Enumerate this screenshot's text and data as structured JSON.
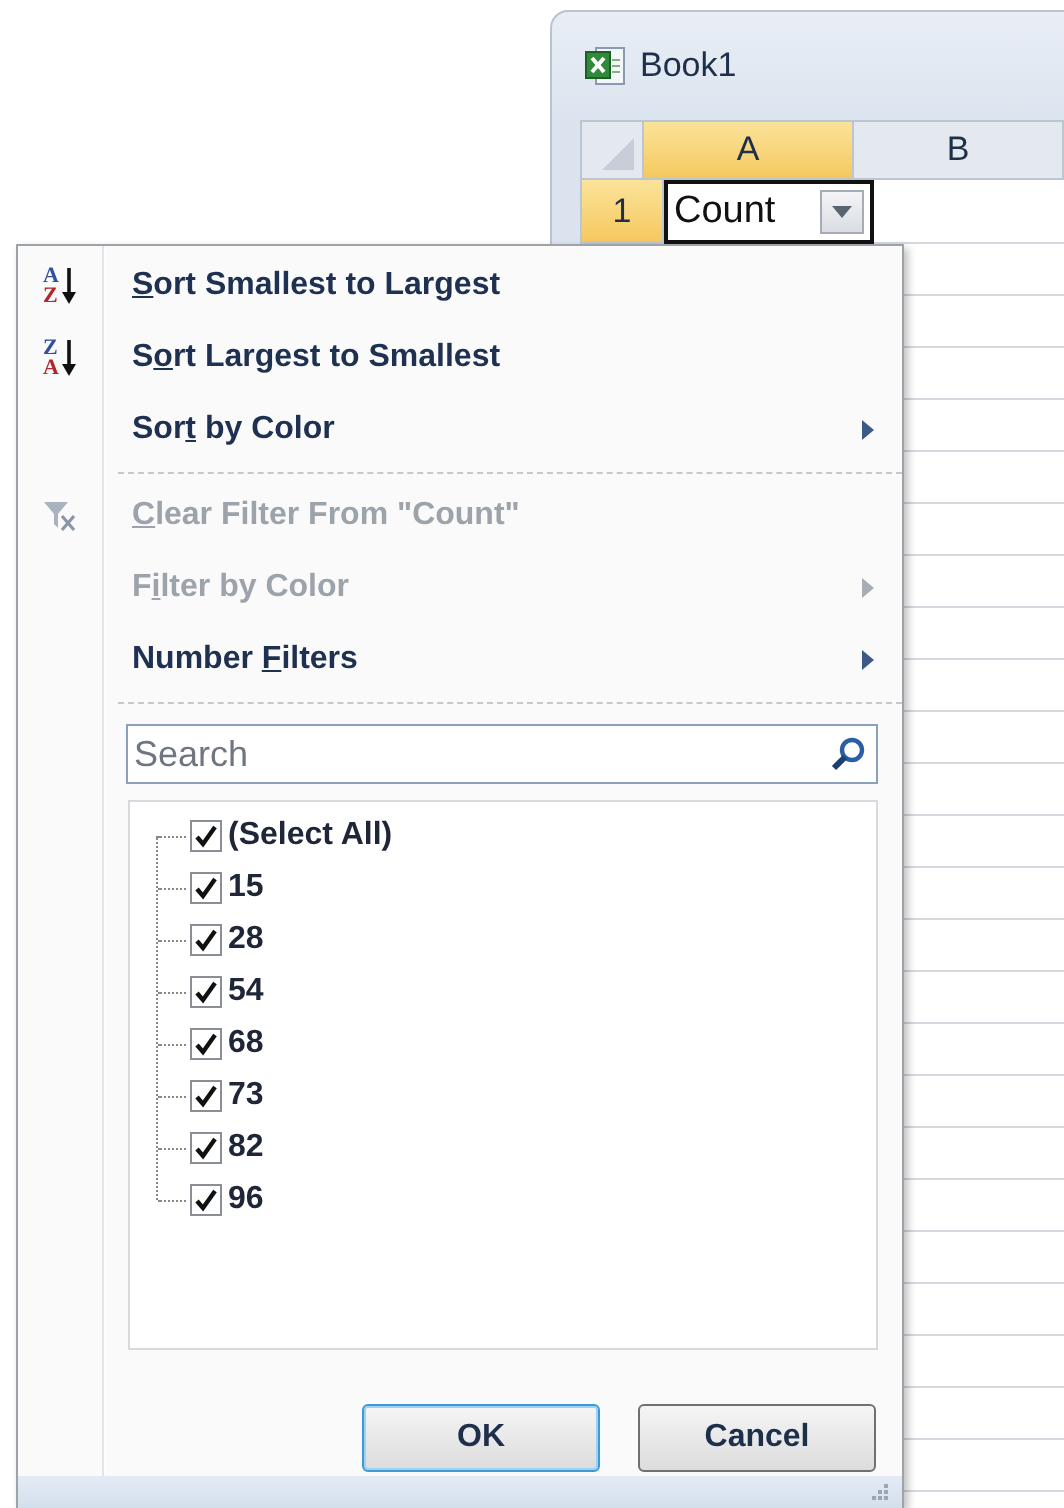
{
  "workbook": {
    "title": "Book1"
  },
  "sheet": {
    "columns": [
      {
        "label": "A",
        "selected": true
      },
      {
        "label": "B",
        "selected": false
      }
    ],
    "rows": [
      {
        "label": "1",
        "selected": true,
        "cells": [
          {
            "value": "Count",
            "filter_button": true
          }
        ]
      }
    ]
  },
  "filter_menu": {
    "items": [
      {
        "kind": "sort",
        "icon_letters": [
          "A",
          "Z"
        ],
        "key": "S",
        "post": "ort Smallest to Largest",
        "disabled": false,
        "submenu": false
      },
      {
        "kind": "sort",
        "icon_letters": [
          "Z",
          "A"
        ],
        "pre": "S",
        "key": "o",
        "post": "rt Largest to Smallest",
        "disabled": false,
        "submenu": false
      },
      {
        "kind": "plain",
        "pre": "Sor",
        "key": "t",
        "post": " by Color",
        "disabled": false,
        "submenu": true
      },
      {
        "kind": "separator"
      },
      {
        "kind": "clear-filter",
        "key": "C",
        "post": "lear Filter From \"Count\"",
        "disabled": true,
        "submenu": false
      },
      {
        "kind": "plain",
        "pre": "F",
        "key": "i",
        "post": "lter by Color",
        "disabled": true,
        "submenu": true
      },
      {
        "kind": "plain",
        "pre": "Number ",
        "key": "F",
        "post": "ilters",
        "disabled": false,
        "submenu": true
      },
      {
        "kind": "separator"
      }
    ],
    "search": {
      "placeholder": "Search"
    },
    "values": [
      {
        "label": "(Select All)",
        "checked": true
      },
      {
        "label": "15",
        "checked": true
      },
      {
        "label": "28",
        "checked": true
      },
      {
        "label": "54",
        "checked": true
      },
      {
        "label": "68",
        "checked": true
      },
      {
        "label": "73",
        "checked": true
      },
      {
        "label": "82",
        "checked": true
      },
      {
        "label": "96",
        "checked": true
      }
    ],
    "buttons": [
      {
        "label": "OK",
        "default": true
      },
      {
        "label": "Cancel",
        "default": false
      }
    ]
  }
}
